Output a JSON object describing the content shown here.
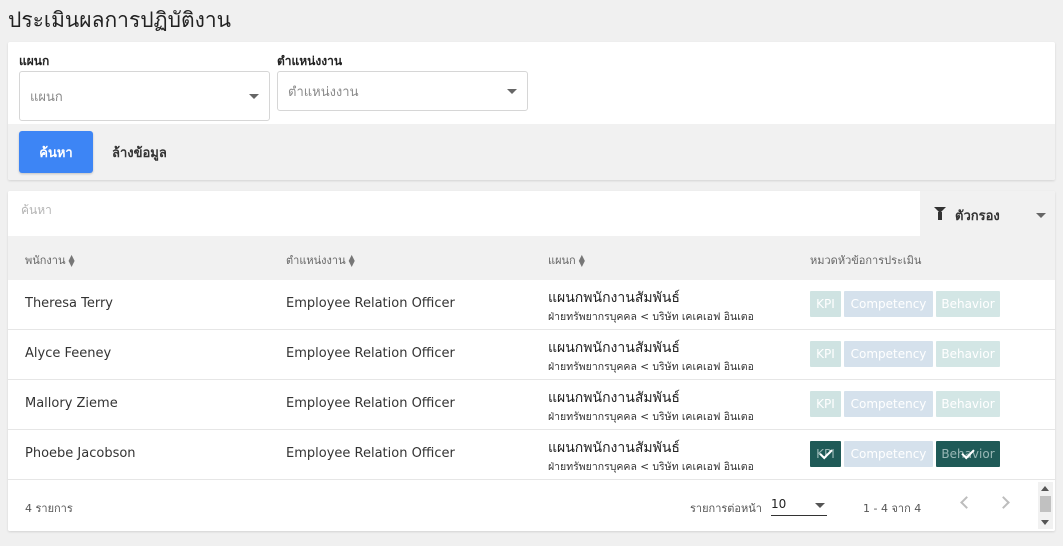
{
  "page": {
    "title": "ประเมินผลการปฏิบัติงาน"
  },
  "filters": {
    "department": {
      "label": "แผนก",
      "placeholder": "แผนก"
    },
    "position": {
      "label": "ตำแหน่งงาน",
      "placeholder": "ตำแหน่งงาน"
    },
    "search_button": "ค้นหา",
    "clear_button": "ล้างข้อมูล"
  },
  "table": {
    "search_placeholder": "ค้นหา",
    "filter_button": "ตัวกรอง",
    "columns": [
      "พนักงาน",
      "ตำแหน่งงาน",
      "แผนก",
      "หมวดหัวข้อการประเมิน"
    ],
    "badge_labels": {
      "kpi": "KPI",
      "competency": "Competency",
      "behavior": "Behavior"
    },
    "rows": [
      {
        "employee": "Theresa Terry",
        "position": "Employee Relation Officer",
        "department": "แผนกพนักงานสัมพันธ์",
        "department_path": "ฝ่ายทรัพยากรบุคคล < บริษัท เคเคเอฟ อินเตอ",
        "kpi_done": false,
        "competency_done": false,
        "behavior_done": false
      },
      {
        "employee": "Alyce Feeney",
        "position": "Employee Relation Officer",
        "department": "แผนกพนักงานสัมพันธ์",
        "department_path": "ฝ่ายทรัพยากรบุคคล < บริษัท เคเคเอฟ อินเตอ",
        "kpi_done": false,
        "competency_done": false,
        "behavior_done": false
      },
      {
        "employee": "Mallory Zieme",
        "position": "Employee Relation Officer",
        "department": "แผนกพนักงานสัมพันธ์",
        "department_path": "ฝ่ายทรัพยากรบุคคล < บริษัท เคเคเอฟ อินเตอ",
        "kpi_done": false,
        "competency_done": false,
        "behavior_done": false
      },
      {
        "employee": "Phoebe Jacobson",
        "position": "Employee Relation Officer",
        "department": "แผนกพนักงานสัมพันธ์",
        "department_path": "ฝ่ายทรัพยากรบุคคล < บริษัท เคเคเอฟ อินเตอ",
        "kpi_done": true,
        "competency_done": false,
        "behavior_done": true
      }
    ],
    "footer": {
      "total": "4 รายการ",
      "per_page_label": "รายการต่อหน้า",
      "per_page_value": "10",
      "range": "1 - 4 จาก 4"
    }
  },
  "colors": {
    "primary": "#3d85f5",
    "badge_done": "#1f5a57",
    "badge_kpi_pending": "#cfe3e2",
    "badge_competency_pending": "#d5e1ec",
    "badge_behavior_pending": "#d3e6e5"
  },
  "icons": [
    "caret-down-icon",
    "filter-icon",
    "sort-icon",
    "check-icon",
    "chevron-left-icon",
    "chevron-right-icon"
  ]
}
